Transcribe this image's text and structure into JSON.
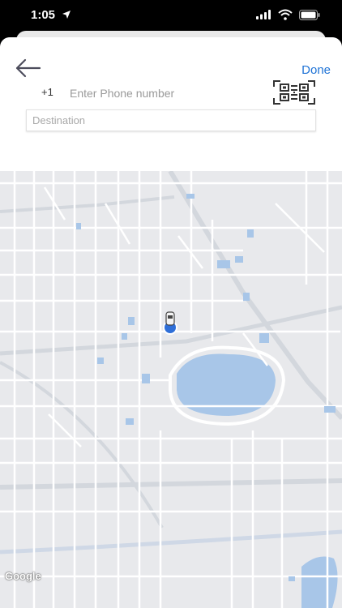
{
  "status": {
    "time": "1:05"
  },
  "header": {
    "done_label": "Done",
    "country_code": "+1",
    "phone_placeholder": "Enter Phone number",
    "destination_placeholder": "Destination"
  },
  "map": {
    "attribution": "Google",
    "marker": "car-marker",
    "water_color": "#a8c6e8",
    "road_color": "#ffffff",
    "land_color": "#e8e9ec"
  },
  "icons": [
    "back-arrow-icon",
    "qr-code-icon",
    "location-arrow-icon",
    "signal-icon",
    "wifi-icon",
    "battery-icon"
  ]
}
